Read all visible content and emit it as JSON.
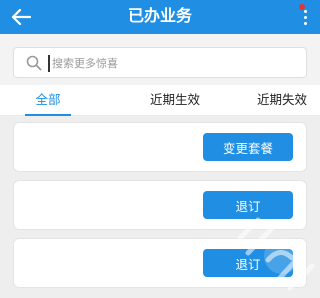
{
  "header": {
    "title": "已办业务",
    "back_icon": "arrow-left-icon",
    "more_icon": "more-vertical-icon",
    "color": "#1f8ee3"
  },
  "search": {
    "placeholder": "搜索更多惊喜",
    "icon": "search-icon"
  },
  "tabs": [
    {
      "label": "全部",
      "active": true
    },
    {
      "label": "近期生效",
      "active": false
    },
    {
      "label": "近期失效",
      "active": false
    }
  ],
  "cards": [
    {
      "button_label": "变更套餐"
    },
    {
      "button_label": "退订"
    },
    {
      "button_label": "退订"
    }
  ],
  "colors": {
    "accent": "#1f8ee3",
    "notification_dot": "#e8332c"
  }
}
